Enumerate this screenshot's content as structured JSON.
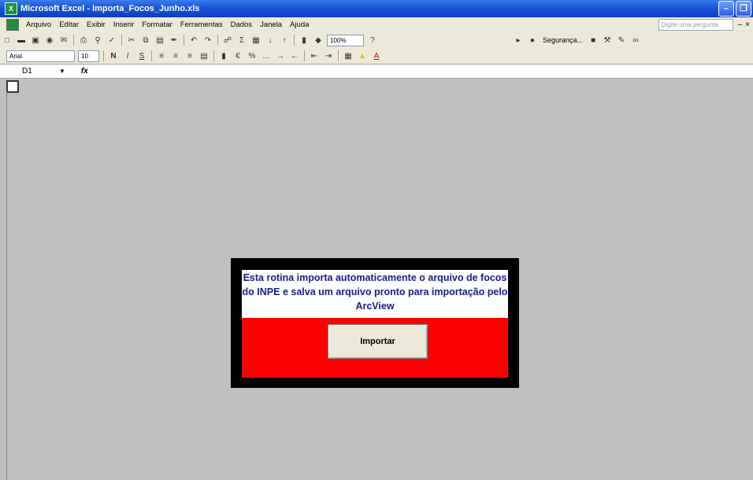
{
  "window": {
    "title": "Microsoft Excel - Importa_Focos_Junho.xls",
    "app_icon_label": "X"
  },
  "menu": {
    "items": [
      "Arquivo",
      "Editar",
      "Exibir",
      "Inserir",
      "Formatar",
      "Ferramentas",
      "Dados",
      "Janela",
      "Ajuda"
    ],
    "help_placeholder": "Digite uma pergunta"
  },
  "toolbar": {
    "zoom": "100%",
    "security_label": "Segurança..."
  },
  "format_toolbar": {
    "font": "Arial",
    "font_size": "10",
    "bold": "N",
    "italic": "I",
    "underline": "S"
  },
  "formula_bar": {
    "cell_ref": "D1",
    "fx_label": "fx"
  },
  "form": {
    "message": "Esta rotina importa automaticamente o arquivo de focos do INPE e salva um arquivo pronto para importação pelo ArcView",
    "button_label": "Importar"
  },
  "colors": {
    "background": "#c0c0c0",
    "panel_border": "#000000",
    "button_area": "#ff0000",
    "message_text": "#1a1a8a"
  }
}
